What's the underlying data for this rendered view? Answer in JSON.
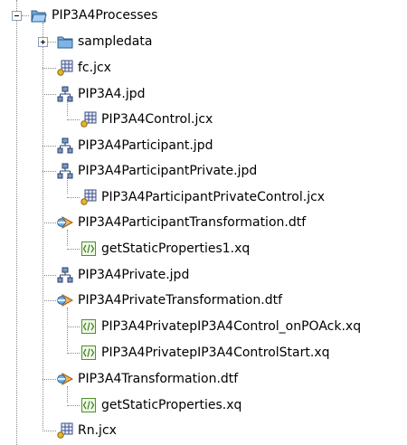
{
  "tree": {
    "root": {
      "label": "PIP3A4Processes",
      "icon": "folder-open-icon"
    },
    "items": [
      {
        "label": "sampledata",
        "icon": "folder-icon",
        "expander": "collapsed"
      },
      {
        "label": "fc.jcx",
        "icon": "control-jcx-icon"
      },
      {
        "label": "PIP3A4.jpd",
        "icon": "process-jpd-icon"
      },
      {
        "label": "PIP3A4Control.jcx",
        "icon": "control-jcx-icon"
      },
      {
        "label": "PIP3A4Participant.jpd",
        "icon": "process-jpd-icon"
      },
      {
        "label": "PIP3A4ParticipantPrivate.jpd",
        "icon": "process-jpd-icon"
      },
      {
        "label": "PIP3A4ParticipantPrivateControl.jcx",
        "icon": "control-jcx-icon"
      },
      {
        "label": "PIP3A4ParticipantTransformation.dtf",
        "icon": "transformation-dtf-icon"
      },
      {
        "label": "getStaticProperties1.xq",
        "icon": "xquery-icon"
      },
      {
        "label": "PIP3A4Private.jpd",
        "icon": "process-jpd-icon"
      },
      {
        "label": "PIP3A4PrivateTransformation.dtf",
        "icon": "transformation-dtf-icon"
      },
      {
        "label": "PIP3A4PrivatepIP3A4Control_onPOAck.xq",
        "icon": "xquery-icon"
      },
      {
        "label": "PIP3A4PrivatepIP3A4ControlStart.xq",
        "icon": "xquery-icon"
      },
      {
        "label": "PIP3A4Transformation.dtf",
        "icon": "transformation-dtf-icon"
      },
      {
        "label": "getStaticProperties.xq",
        "icon": "xquery-icon"
      },
      {
        "label": "Rn.jcx",
        "icon": "control-jcx-icon"
      }
    ]
  }
}
